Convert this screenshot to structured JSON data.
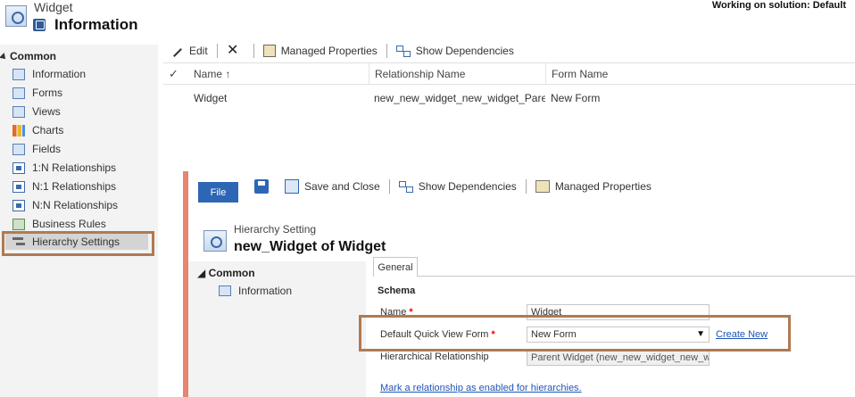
{
  "header": {
    "entity_name": "Widget",
    "page_title": "Information",
    "solution": "Working on solution: Default"
  },
  "sidebar": {
    "section": "Common",
    "items": [
      {
        "label": "Information",
        "icon": "information-icon"
      },
      {
        "label": "Forms",
        "icon": "forms-icon"
      },
      {
        "label": "Views",
        "icon": "views-icon"
      },
      {
        "label": "Charts",
        "icon": "charts-icon"
      },
      {
        "label": "Fields",
        "icon": "fields-icon"
      },
      {
        "label": "1:N Relationships",
        "icon": "relationship-icon"
      },
      {
        "label": "N:1 Relationships",
        "icon": "relationship-icon"
      },
      {
        "label": "N:N Relationships",
        "icon": "relationship-icon"
      },
      {
        "label": "Business Rules",
        "icon": "business-rules-icon"
      },
      {
        "label": "Hierarchy Settings",
        "icon": "hierarchy-icon"
      }
    ],
    "selected": "Hierarchy Settings"
  },
  "toolbar": {
    "edit_label": "Edit",
    "delete_glyph": "✕",
    "managed_properties_label": "Managed Properties",
    "show_dependencies_label": "Show Dependencies"
  },
  "grid": {
    "check_glyph": "✓",
    "columns": [
      "Name ↑",
      "Relationship Name",
      "Form Name"
    ],
    "rows": [
      [
        "Widget",
        "new_new_widget_new_widget_Parent...",
        "New Form"
      ]
    ]
  },
  "dialog": {
    "file_tab": "File",
    "save_close_label": "Save and Close",
    "show_dependencies_label": "Show Dependencies",
    "managed_properties_label": "Managed Properties",
    "entity_label": "Hierarchy Setting",
    "title": "new_Widget of Widget",
    "nav_section": "Common",
    "nav_item": "Information",
    "tab_label": "General",
    "section_title": "Schema",
    "fields": {
      "name_label": "Name",
      "name_value": "Widget",
      "quick_view_label": "Default Quick View Form",
      "quick_view_value": "New Form",
      "create_new": "Create New",
      "hier_rel_label": "Hierarchical Relationship",
      "hier_rel_value": "Parent Widget (new_new_widget_new_wid"
    },
    "mark_link": "Mark a relationship as enabled for hierarchies.",
    "required_glyph": "*",
    "dropdown_glyph": "▼"
  },
  "colors": {
    "highlight": "#b07a52",
    "accent": "#2e66b6",
    "dialog_edge": "#e8846f",
    "link": "#1f55b5"
  }
}
